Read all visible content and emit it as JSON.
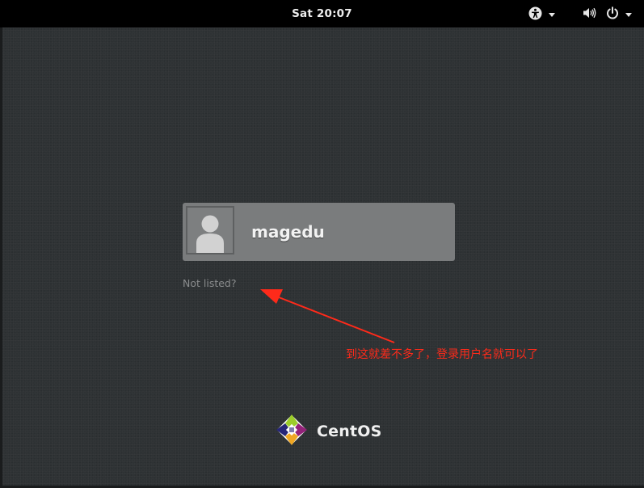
{
  "top_bar": {
    "clock": "Sat 20:07",
    "icons": [
      "accessibility-icon",
      "volume-icon",
      "power-icon",
      "chevron-down-icon"
    ]
  },
  "user_list": {
    "users": [
      {
        "name": "magedu",
        "avatar": "default-user-avatar-icon"
      }
    ],
    "not_listed": "Not listed?"
  },
  "annotation": {
    "text": "到这就差不多了，登录用户名就可以了",
    "color": "#ff2a1a"
  },
  "branding": {
    "logo_text": "CentOS"
  },
  "colors": {
    "background": "#2e3234",
    "top_bar": "#000000",
    "card": "#7a7c7d"
  }
}
